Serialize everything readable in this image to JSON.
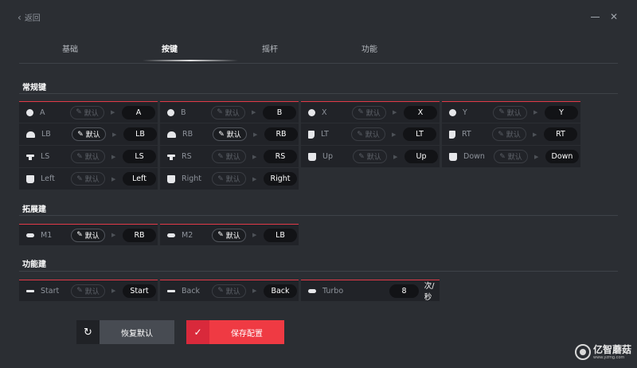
{
  "header": {
    "back_label": "返回",
    "minimize_icon": "minimize-icon",
    "close_symbol": "✕"
  },
  "tabs": [
    {
      "label": "基础"
    },
    {
      "label": "按键"
    },
    {
      "label": "摇杆"
    },
    {
      "label": "功能"
    }
  ],
  "active_tab": "按键",
  "sections": {
    "standard": "常规键",
    "extended": "拓展建",
    "function": "功能建"
  },
  "default_label": "默认",
  "standard_keys": [
    {
      "icon": "circle",
      "label": "A",
      "value": "A",
      "default_active": false
    },
    {
      "icon": "circle",
      "label": "B",
      "value": "B",
      "default_active": false
    },
    {
      "icon": "circle",
      "label": "X",
      "value": "X",
      "default_active": false
    },
    {
      "icon": "circle",
      "label": "Y",
      "value": "Y",
      "default_active": false
    },
    {
      "icon": "shoulder",
      "label": "LB",
      "value": "LB",
      "default_active": true
    },
    {
      "icon": "shoulder",
      "label": "RB",
      "value": "RB",
      "default_active": true
    },
    {
      "icon": "trigger",
      "label": "LT",
      "value": "LT",
      "default_active": false
    },
    {
      "icon": "trigger",
      "label": "RT",
      "value": "RT",
      "default_active": false
    },
    {
      "icon": "stick",
      "label": "LS",
      "value": "LS",
      "default_active": false
    },
    {
      "icon": "stick",
      "label": "RS",
      "value": "RS",
      "default_active": false
    },
    {
      "icon": "pad",
      "label": "Up",
      "value": "Up",
      "default_active": false
    },
    {
      "icon": "pad",
      "label": "Down",
      "value": "Down",
      "default_active": false
    },
    {
      "icon": "pad",
      "label": "Left",
      "value": "Left",
      "default_active": false
    },
    {
      "icon": "pad",
      "label": "Right",
      "value": "Right",
      "default_active": false
    }
  ],
  "extended_keys": [
    {
      "icon": "pill",
      "label": "M1",
      "value": "RB",
      "default_active": true
    },
    {
      "icon": "pill",
      "label": "M2",
      "value": "LB",
      "default_active": true
    }
  ],
  "function_keys": [
    {
      "icon": "bar",
      "label": "Start",
      "value": "Start",
      "default_active": false
    },
    {
      "icon": "bar",
      "label": "Back",
      "value": "Back",
      "default_active": false
    },
    {
      "icon": "pill",
      "label": "Turbo",
      "value": "8",
      "unit": "次/秒"
    }
  ],
  "buttons": {
    "reset": "恢复默认",
    "save": "保存配置"
  },
  "watermark": {
    "name": "亿智蘑菇",
    "url": "www.yzmg.com"
  },
  "colors": {
    "accent": "#e23a48",
    "save_bg": "#ef3a43",
    "background": "#2b2e33",
    "card_bg": "#212328"
  }
}
